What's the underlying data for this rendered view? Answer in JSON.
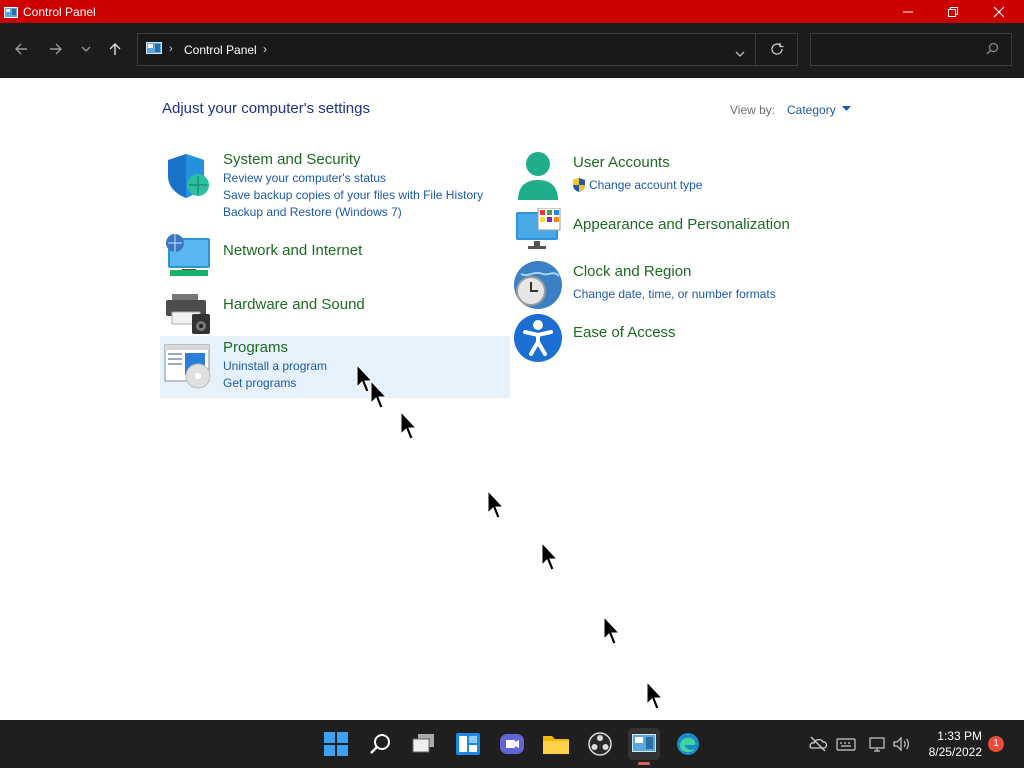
{
  "window": {
    "title": "Control Panel",
    "minimize_icon": "minimize-icon",
    "maximize_icon": "maximize-icon",
    "close_icon": "close-icon"
  },
  "address": {
    "breadcrumb": "Control Panel",
    "back_icon": "back-arrow-icon",
    "forward_icon": "forward-arrow-icon",
    "recent_icon": "chevron-down-icon",
    "up_icon": "up-arrow-icon",
    "dropdown_icon": "chevron-down-icon",
    "refresh_icon": "refresh-icon",
    "search_placeholder": "",
    "search_icon": "search-icon"
  },
  "main": {
    "heading": "Adjust your computer's settings",
    "view_by_label": "View by:",
    "view_by_value": "Category"
  },
  "categories_left": [
    {
      "title": "System and Security",
      "icon": "shield-icon",
      "links": [
        "Review your computer's status",
        "Save backup copies of your files with File History",
        "Backup and Restore (Windows 7)"
      ]
    },
    {
      "title": "Network and Internet",
      "icon": "network-globe-icon",
      "links": []
    },
    {
      "title": "Hardware and Sound",
      "icon": "printer-speaker-icon",
      "links": []
    },
    {
      "title": "Programs",
      "icon": "programs-disc-icon",
      "links": [
        "Uninstall a program",
        "Get programs"
      ]
    }
  ],
  "categories_right": [
    {
      "title": "User Accounts",
      "icon": "user-icon",
      "links": [
        "Change account type"
      ],
      "link_icon": "uac-shield-icon"
    },
    {
      "title": "Appearance and Personalization",
      "icon": "monitor-palette-icon",
      "links": []
    },
    {
      "title": "Clock and Region",
      "icon": "clock-globe-icon",
      "links": [
        "Change date, time, or number formats"
      ]
    },
    {
      "title": "Ease of Access",
      "icon": "accessibility-icon",
      "links": []
    }
  ],
  "taskbar": {
    "apps": [
      "windows-start-icon",
      "search-icon",
      "task-view-icon",
      "widgets-icon",
      "teams-chat-icon",
      "file-explorer-icon",
      "obs-icon",
      "control-panel-icon",
      "edge-icon"
    ],
    "tray": [
      "onedrive-offline-icon",
      "keyboard-icon",
      "network-icon",
      "volume-icon"
    ],
    "time": "1:33 PM",
    "date": "8/25/2022",
    "notification_count": "1"
  },
  "colors": {
    "titlebar": "#cc0000",
    "address_bg": "#1c1c1c",
    "heading": "#1e3287",
    "category_title": "#1d6b22",
    "link": "#1e5aa8",
    "highlight": "#e5f1fb",
    "taskbar": "#1f1f1f"
  }
}
